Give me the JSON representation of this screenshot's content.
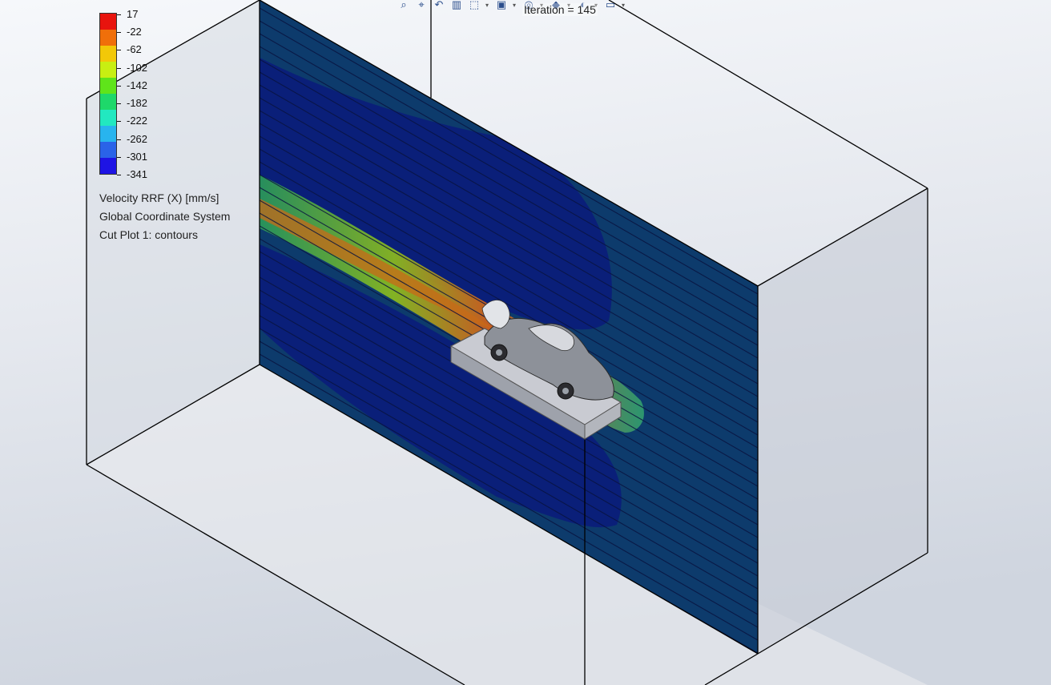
{
  "toolbar": {
    "icons": [
      "zoom-to-fit-icon",
      "zoom-area-icon",
      "previous-view-icon",
      "section-view-icon",
      "view-orientation-icon",
      "display-style-icon",
      "hide-show-icon",
      "edit-appearance-icon",
      "apply-scene-icon",
      "view-settings-icon"
    ]
  },
  "status": {
    "iteration_text": "Iteration = 145"
  },
  "legend": {
    "values": [
      "17",
      "-22",
      "-62",
      "-102",
      "-142",
      "-182",
      "-222",
      "-262",
      "-301",
      "-341"
    ],
    "colors": [
      "#e8140e",
      "#f06f0a",
      "#f2c808",
      "#c8ef12",
      "#5fe41a",
      "#1ed86a",
      "#22e8c0",
      "#28b4ee",
      "#2a63e8",
      "#1e14e4"
    ],
    "quantity": "Velocity RRF (X) [mm/s]",
    "coordinate_system": "Global Coordinate System",
    "plot_name": "Cut Plot 1: contours"
  },
  "palette": {
    "background_top": "#f4f6f9",
    "background_bottom": "#d5dae3",
    "plane_dark": "#08207a",
    "plane_mid": "#0c3a6e",
    "box_edge": "#000000"
  }
}
